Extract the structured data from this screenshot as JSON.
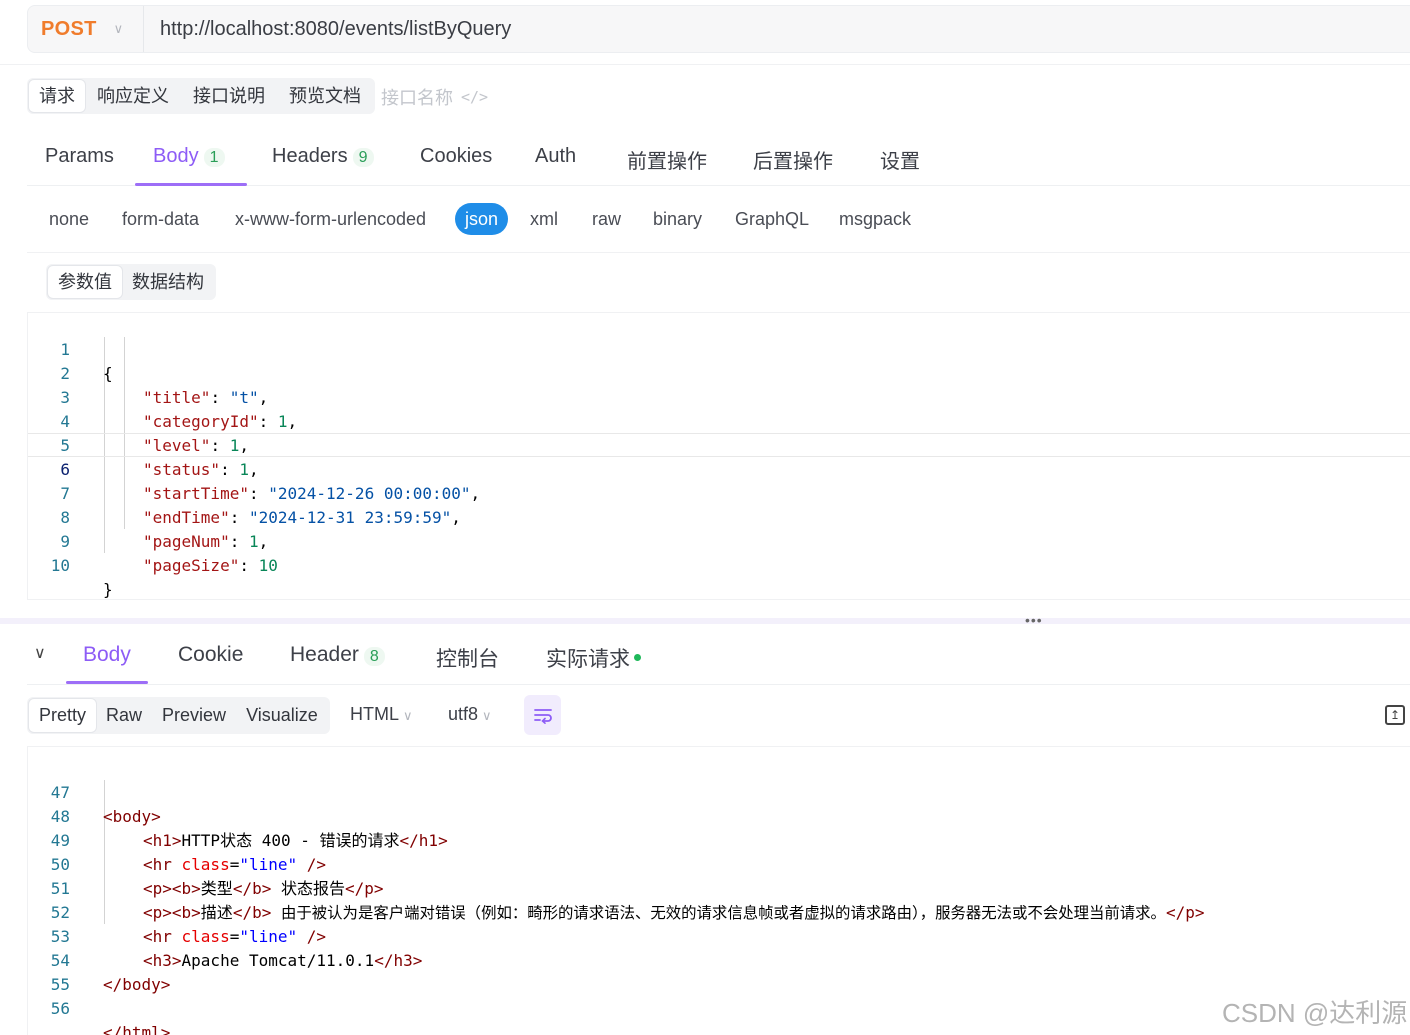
{
  "request": {
    "method": "POST",
    "url": "http://localhost:8080/events/listByQuery"
  },
  "top_tabs": [
    "请求",
    "响应定义",
    "接口说明",
    "预览文档"
  ],
  "api_name_placeholder": "接口名称",
  "main_tabs": {
    "params": "Params",
    "body": "Body",
    "body_count": "1",
    "headers": "Headers",
    "headers_count": "9",
    "cookies": "Cookies",
    "auth": "Auth",
    "pre": "前置操作",
    "post": "后置操作",
    "settings": "设置"
  },
  "body_types": [
    "none",
    "form-data",
    "x-www-form-urlencoded",
    "json",
    "xml",
    "raw",
    "binary",
    "GraphQL",
    "msgpack"
  ],
  "body_type_selected": "json",
  "param_tabs": [
    "参数值",
    "数据结构"
  ],
  "request_body_lines": [
    {
      "no": "1",
      "text": "{"
    },
    {
      "no": "2",
      "key": "\"title\"",
      "sep": ": ",
      "val": "\"t\"",
      "val_type": "string",
      "end": ","
    },
    {
      "no": "3",
      "key": "\"categoryId\"",
      "sep": ": ",
      "val": "1",
      "val_type": "number",
      "end": ","
    },
    {
      "no": "4",
      "key": "\"level\"",
      "sep": ": ",
      "val": "1",
      "val_type": "number",
      "end": ","
    },
    {
      "no": "5",
      "key": "\"status\"",
      "sep": ": ",
      "val": "1",
      "val_type": "number",
      "end": ","
    },
    {
      "no": "6",
      "key": "\"startTime\"",
      "sep": ": ",
      "val": "\"2024-12-26 00:00:00\"",
      "val_type": "string",
      "end": ","
    },
    {
      "no": "7",
      "key": "\"endTime\"",
      "sep": ": ",
      "val": "\"2024-12-31 23:59:59\"",
      "val_type": "string",
      "end": ","
    },
    {
      "no": "8",
      "key": "\"pageNum\"",
      "sep": ": ",
      "val": "1",
      "val_type": "number",
      "end": ","
    },
    {
      "no": "9",
      "key": "\"pageSize\"",
      "sep": ": ",
      "val": "10",
      "val_type": "number",
      "end": ""
    },
    {
      "no": "10",
      "text": "}"
    }
  ],
  "response_tabs": {
    "body": "Body",
    "cookie": "Cookie",
    "header": "Header",
    "header_count": "8",
    "console": "控制台",
    "actual_request": "实际请求"
  },
  "view_modes": [
    "Pretty",
    "Raw",
    "Preview",
    "Visualize"
  ],
  "format_select": "HTML",
  "encoding_select": "utf8",
  "response_lines": {
    "l47": {
      "no": "47",
      "text": "<body>"
    },
    "l48": {
      "no": "48",
      "open": "<h1>",
      "mid1": "HTTP",
      "cn": "状态",
      "mid2": " 400 - ",
      "cn2": "错误的请求",
      "close": "</h1>"
    },
    "l49": {
      "no": "49",
      "tag": "<hr ",
      "attr": "class",
      "eq": "=",
      "val": "\"line\"",
      "end": " />"
    },
    "l50": {
      "no": "50",
      "p1": "<p><b>",
      "cn": "类型",
      "p2": "</b> ",
      "cn2": "状态报告",
      "p3": "</p>"
    },
    "l51": {
      "no": "51",
      "p1": "<p><b>",
      "cn": "描述",
      "p2": "</b> ",
      "cn2": "由于被认为是客户端对错误（例如：畸形的请求语法、无效的请求信息帧或者虚拟的请求路由），服务器无法或不会处理当前请求。",
      "p3": "</p>"
    },
    "l52": {
      "no": "52",
      "tag": "<hr ",
      "attr": "class",
      "eq": "=",
      "val": "\"line\"",
      "end": " />"
    },
    "l53": {
      "no": "53",
      "open": "<h3>",
      "text": "Apache Tomcat/11.0.1",
      "close": "</h3>"
    },
    "l54": {
      "no": "54",
      "text": "</body>"
    },
    "l55": {
      "no": "55",
      "text": ""
    },
    "l56": {
      "no": "56",
      "text": "</html>"
    }
  },
  "watermark": "CSDN @达利源",
  "colors": {
    "method": "#f07c2c",
    "accent": "#8d5cf6",
    "json_selected": "#1f8de8",
    "count_green": "#2a9e58"
  }
}
